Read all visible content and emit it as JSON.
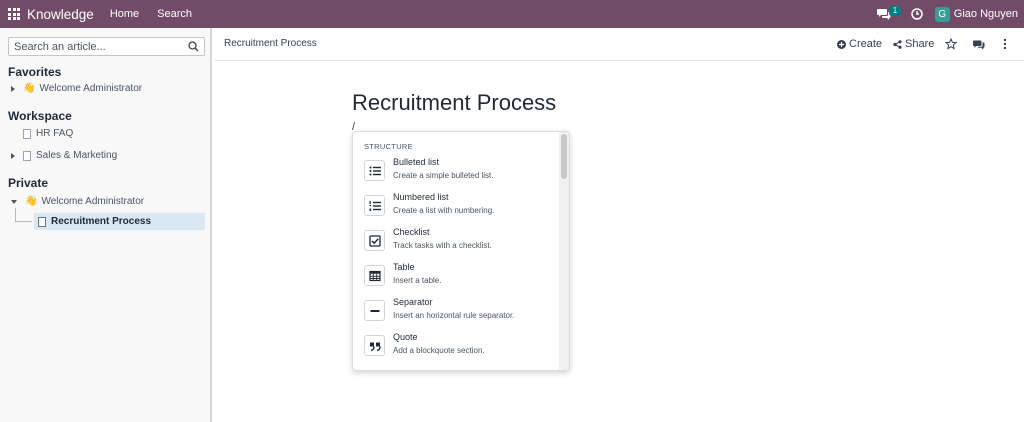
{
  "navbar": {
    "brand": "Knowledge",
    "menus": [
      "Home",
      "Search"
    ],
    "chat_badge": "1",
    "user_initial": "G",
    "user_name": "Giao Nguyen",
    "bg_color": "#714B67"
  },
  "sidebar": {
    "search_placeholder": "Search an article...",
    "sections": {
      "favorites": "Favorites",
      "workspace": "Workspace",
      "private": "Private"
    },
    "favorites": [
      {
        "emoji": "👋",
        "label": "Welcome Administrator",
        "icon": "caret-right-icon"
      }
    ],
    "workspace": [
      {
        "label": "HR FAQ",
        "icon": "page-icon"
      },
      {
        "label": "Sales & Marketing",
        "icon": "page-icon"
      }
    ],
    "private": [
      {
        "emoji": "👋",
        "label": "Welcome Administrator",
        "icon": "caret-down-icon"
      },
      {
        "label": "Recruitment Process",
        "icon": "page-icon",
        "active": true
      }
    ]
  },
  "header": {
    "breadcrumb": "Recruitment Process",
    "create_label": "Create",
    "share_label": "Share"
  },
  "article": {
    "title": "Recruitment Process",
    "typed": "/"
  },
  "powerbox": {
    "category": "STRUCTURE",
    "items": [
      {
        "title": "Bulleted list",
        "desc": "Create a simple bulleted list.",
        "icon": "bulleted-list-icon"
      },
      {
        "title": "Numbered list",
        "desc": "Create a list with numbering.",
        "icon": "numbered-list-icon"
      },
      {
        "title": "Checklist",
        "desc": "Track tasks with a checklist.",
        "icon": "checklist-icon"
      },
      {
        "title": "Table",
        "desc": "Insert a table.",
        "icon": "table-icon"
      },
      {
        "title": "Separator",
        "desc": "Insert an horizontal rule separator.",
        "icon": "separator-icon"
      },
      {
        "title": "Quote",
        "desc": "Add a blockquote section.",
        "icon": "quote-icon"
      }
    ]
  }
}
